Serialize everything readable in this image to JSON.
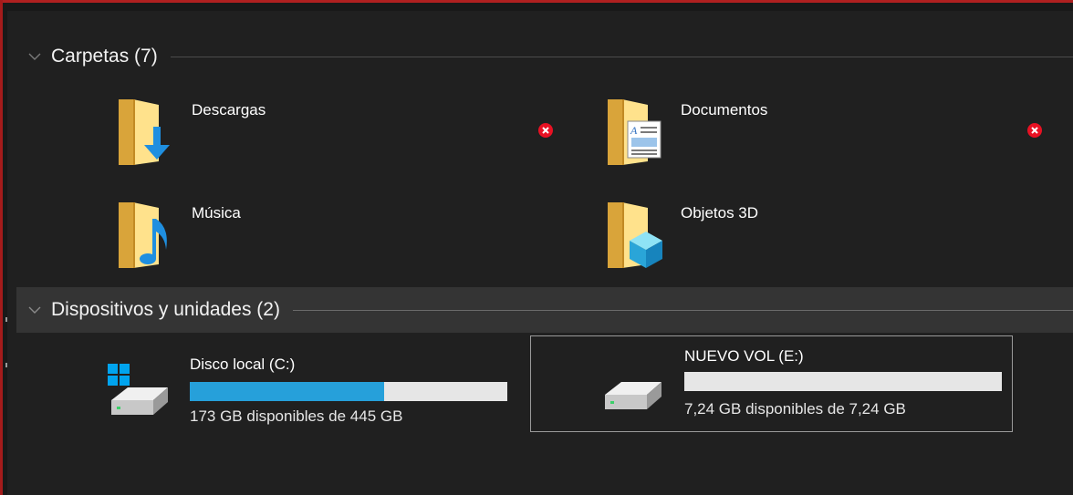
{
  "groups": {
    "folders": {
      "title": "Carpetas (7)",
      "items": [
        {
          "label": "Descargas"
        },
        {
          "label": "Documentos"
        },
        {
          "label": "Música"
        },
        {
          "label": "Objetos 3D"
        }
      ]
    },
    "devices": {
      "title": "Dispositivos y unidades (2)",
      "items": [
        {
          "label": "Disco local (C:)",
          "capacity": "173 GB disponibles de 445 GB",
          "used_fraction": 0.611
        },
        {
          "label": "NUEVO VOL (E:)",
          "capacity": "7,24 GB disponibles de 7,24 GB",
          "used_fraction": 0.0
        }
      ]
    }
  },
  "icons": {
    "chevron": "chevron-down-icon",
    "downloads": "downloads-folder-icon",
    "documents": "documents-folder-icon",
    "music": "music-folder-icon",
    "objects3d": "objects-3d-folder-icon",
    "error": "error-badge-icon",
    "drive_c": "windows-drive-icon",
    "drive_e": "hard-drive-icon"
  },
  "colors": {
    "background": "#191919",
    "accent_bar": "#26a0da",
    "error_red": "#e81123",
    "frame_red": "#b02020"
  }
}
